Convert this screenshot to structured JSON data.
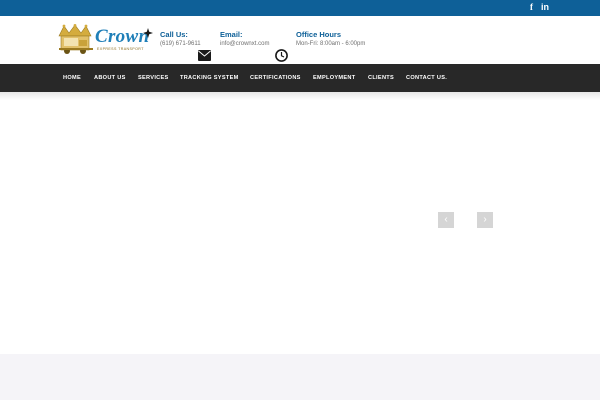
{
  "topbar": {
    "social": {
      "facebook": "f",
      "linkedin": "in"
    }
  },
  "header": {
    "logo": {
      "word": "Crown",
      "subtitle": "EXPRESS TRANSPORT"
    },
    "call": {
      "title": "Call Us:",
      "text": "(619) 671-9611"
    },
    "email": {
      "title": "Email:",
      "text": "info@crownxt.com",
      "icon": "envelope-icon"
    },
    "hours": {
      "title": "Office Hours",
      "text": "Mon-Fri: 8:00am - 6:00pm",
      "icon": "clock-icon"
    }
  },
  "nav": {
    "items": [
      {
        "label": "HOME"
      },
      {
        "label": "ABOUT US"
      },
      {
        "label": "SERVICES"
      },
      {
        "label": "TRACKING SYSTEM"
      },
      {
        "label": "CERTIFICATIONS"
      },
      {
        "label": "EMPLOYMENT"
      },
      {
        "label": "CLIENTS"
      },
      {
        "label": "CONTACT US."
      }
    ]
  },
  "slider": {
    "prev_label": "‹",
    "next_label": "›"
  },
  "colors": {
    "brand_blue": "#0e6098",
    "nav_bg": "#282828",
    "logo_gold": "#c9a23a",
    "footer_band": "#f5f4f8"
  }
}
